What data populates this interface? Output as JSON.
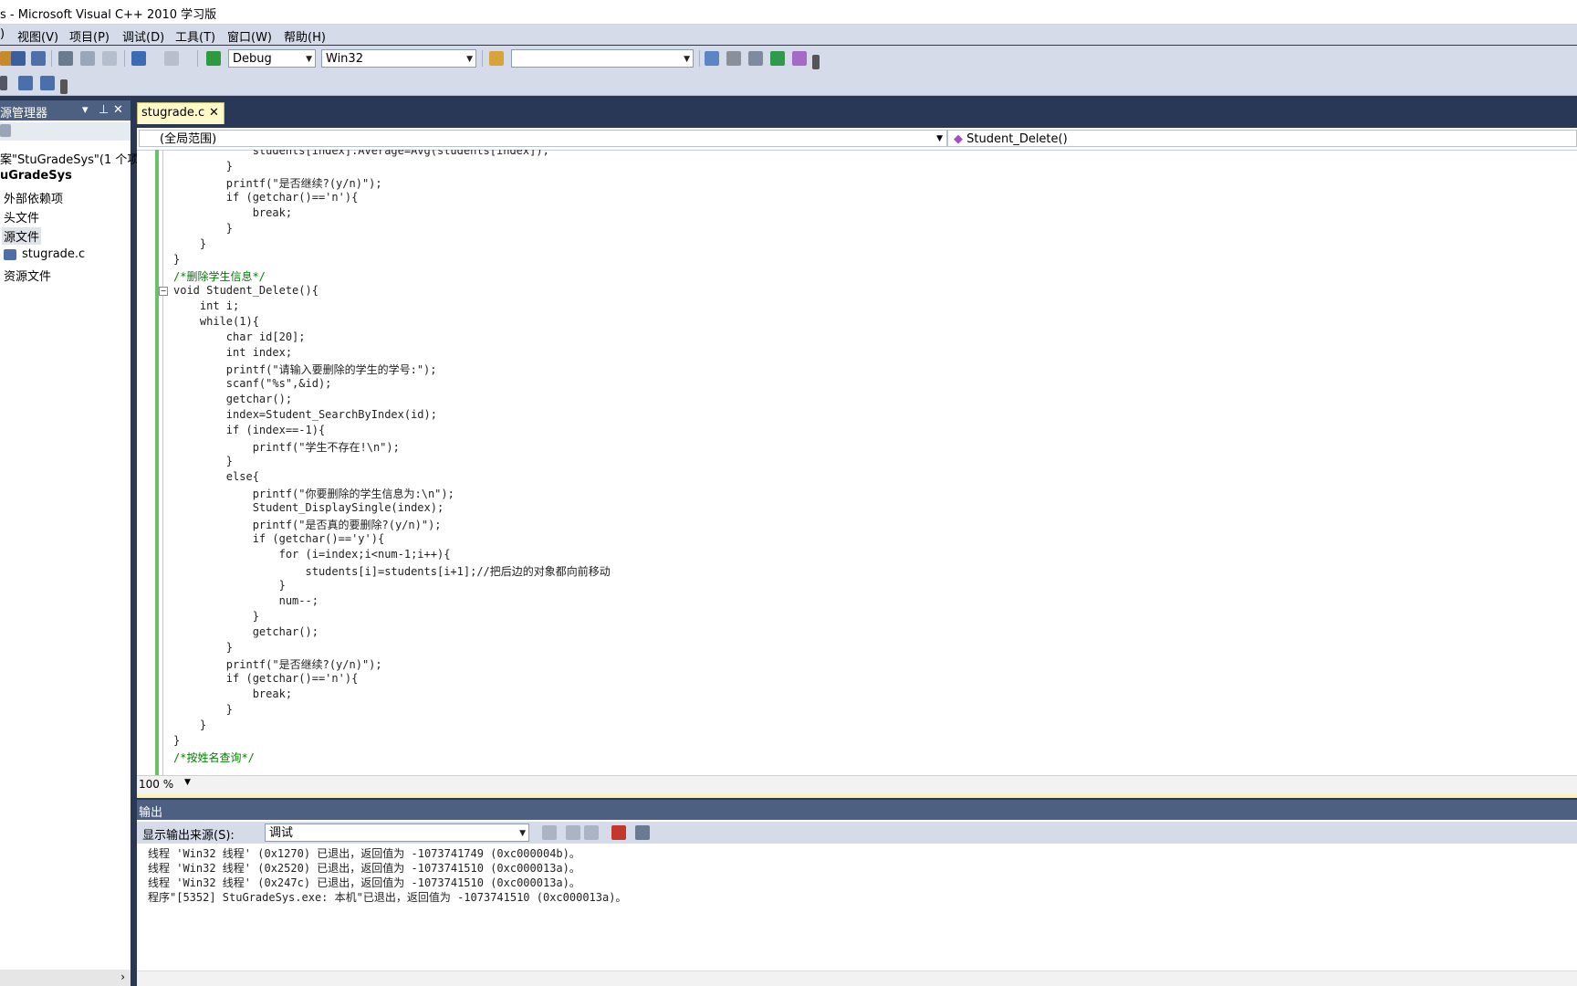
{
  "window": {
    "title": "s - Microsoft Visual C++ 2010 学习版"
  },
  "menu": {
    "items": [
      ")",
      "视图(V)",
      "项目(P)",
      "调试(D)",
      "工具(T)",
      "窗口(W)",
      "帮助(H)"
    ]
  },
  "toolbar": {
    "config": "Debug",
    "platform": "Win32",
    "find_value": ""
  },
  "solution_explorer": {
    "title": "源管理器",
    "tree": [
      "案\"StuGradeSys\"(1 个项",
      "uGradeSys",
      "外部依赖项",
      "头文件",
      "源文件",
      "stugrade.c",
      "资源文件"
    ]
  },
  "editor": {
    "tab_label": "stugrade.c",
    "tab_close": "✕",
    "scope": "(全局范围)",
    "member": "Student_Delete()",
    "zoom": "100 %",
    "lines": [
      "            students[index].Average=Avg(students[index]);",
      "        }",
      "        printf(\"是否继续?(y/n)\");",
      "        if (getchar()=='n'){",
      "            break;",
      "        }",
      "    }",
      "}",
      "/*删除学生信息*/",
      "void Student_Delete(){",
      "    int i;",
      "    while(1){",
      "        char id[20];",
      "        int index;",
      "        printf(\"请输入要删除的学生的学号:\");",
      "        scanf(\"%s\",&id);",
      "        getchar();",
      "        index=Student_SearchByIndex(id);",
      "        if (index==-1){",
      "            printf(\"学生不存在!\\n\");",
      "        }",
      "        else{",
      "            printf(\"你要删除的学生信息为:\\n\");",
      "            Student_DisplaySingle(index);",
      "            printf(\"是否真的要删除?(y/n)\");",
      "            if (getchar()=='y'){",
      "                for (i=index;i<num-1;i++){",
      "                    students[i]=students[i+1];//把后边的对象都向前移动",
      "                }",
      "                num--;",
      "            }",
      "            getchar();",
      "        }",
      "        printf(\"是否继续?(y/n)\");",
      "        if (getchar()=='n'){",
      "            break;",
      "        }",
      "    }",
      "}",
      "/*按姓名查询*/"
    ]
  },
  "output": {
    "title": "输出",
    "source_label": "显示输出来源(S):",
    "source_value": "调试",
    "lines": [
      "线程 'Win32 线程' (0x1270) 已退出，返回值为 -1073741749 (0xc000004b)。",
      "线程 'Win32 线程' (0x2520) 已退出，返回值为 -1073741510 (0xc000013a)。",
      "线程 'Win32 线程' (0x247c) 已退出，返回值为 -1073741510 (0xc000013a)。",
      "程序\"[5352] StuGradeSys.exe: 本机\"已退出，返回值为 -1073741510 (0xc000013a)。"
    ]
  }
}
